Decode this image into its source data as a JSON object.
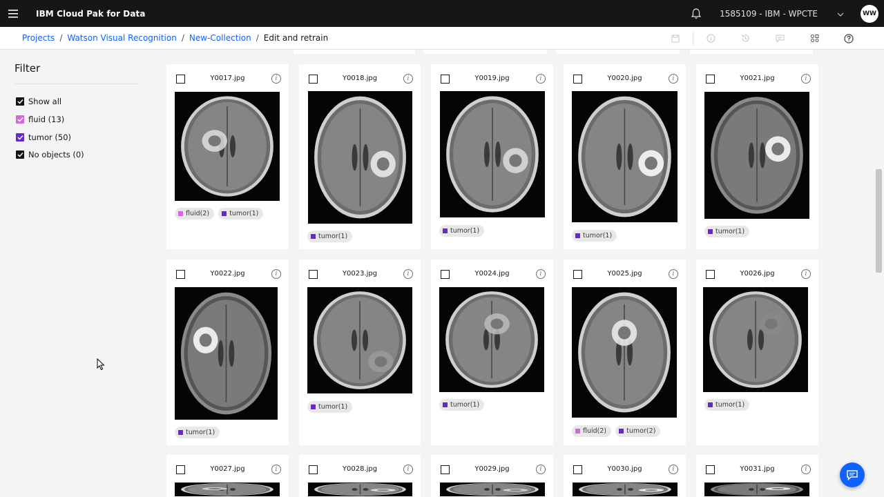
{
  "header": {
    "app_title": "IBM Cloud Pak for Data",
    "account": "1585109 - IBM - WPCTE",
    "avatar_initials": "WW"
  },
  "breadcrumb": {
    "items": [
      "Projects",
      "Watson Visual Recognition",
      "New-Collection"
    ],
    "current": "Edit and retrain"
  },
  "filter": {
    "title": "Filter",
    "items": [
      {
        "label": "Show all",
        "color": "#161616"
      },
      {
        "label": "fluid (13)",
        "color": "#d16ad8"
      },
      {
        "label": "tumor (50)",
        "color": "#6929c4"
      },
      {
        "label": "No objects (0)",
        "color": "#161616"
      }
    ]
  },
  "images": [
    {
      "name": "Y0017.jpg",
      "tags": [
        "fluid(2)",
        "tumor(1)"
      ]
    },
    {
      "name": "Y0018.jpg",
      "tags": [
        "tumor(1)"
      ]
    },
    {
      "name": "Y0019.jpg",
      "tags": [
        "tumor(1)"
      ]
    },
    {
      "name": "Y0020.jpg",
      "tags": [
        "tumor(1)"
      ]
    },
    {
      "name": "Y0021.jpg",
      "tags": [
        "tumor(1)"
      ]
    },
    {
      "name": "Y0022.jpg",
      "tags": [
        "tumor(1)"
      ]
    },
    {
      "name": "Y0023.jpg",
      "tags": [
        "tumor(1)"
      ]
    },
    {
      "name": "Y0024.jpg",
      "tags": [
        "tumor(1)"
      ]
    },
    {
      "name": "Y0025.jpg",
      "tags": [
        "fluid(2)",
        "tumor(2)"
      ]
    },
    {
      "name": "Y0026.jpg",
      "tags": [
        "tumor(1)"
      ]
    },
    {
      "name": "Y0027.jpg",
      "tags": []
    },
    {
      "name": "Y0028.jpg",
      "tags": []
    },
    {
      "name": "Y0029.jpg",
      "tags": []
    },
    {
      "name": "Y0030.jpg",
      "tags": []
    },
    {
      "name": "Y0031.jpg",
      "tags": []
    }
  ],
  "colors": {
    "fluid": "#d16ad8",
    "tumor": "#6929c4",
    "accent": "#0f62fe"
  },
  "icons": [
    "menu-icon",
    "notification-bell-icon",
    "chevron-down-icon",
    "save-icon",
    "info-icon",
    "history-icon",
    "comment-icon",
    "settings-icon",
    "help-icon",
    "chat-icon"
  ]
}
